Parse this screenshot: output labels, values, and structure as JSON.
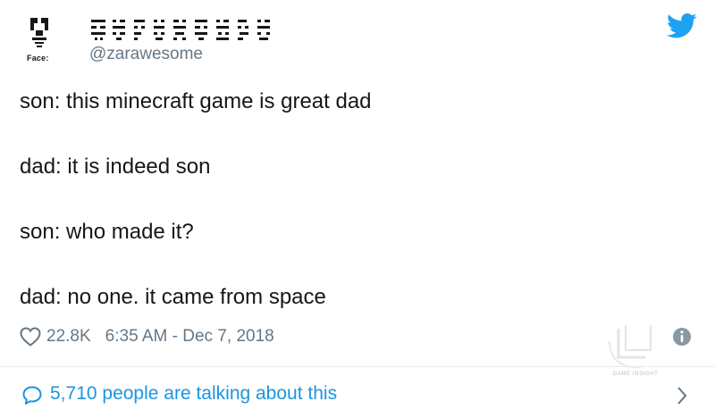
{
  "header": {
    "avatar_caption": "Face:",
    "display_name_icons": "pixel-glyph-name",
    "username": "@zarawesome",
    "brand_icon": "twitter-bird-icon"
  },
  "tweet": {
    "lines": [
      "son: this minecraft game is great dad",
      "dad: it is indeed son",
      "son: who made it?",
      "dad: no one. it came from space"
    ]
  },
  "meta": {
    "likes": "22.8K",
    "timestamp": "6:35 AM - Dec 7, 2018"
  },
  "watermark": {
    "text": "GAME INSIGHT"
  },
  "footer": {
    "talking_text": "5,710 people are talking about this"
  },
  "colors": {
    "text": "#14171a",
    "secondary": "#657786",
    "twitter_blue": "#1da1f2",
    "link_blue": "#1b95e0",
    "divider": "#e6ecf0"
  }
}
